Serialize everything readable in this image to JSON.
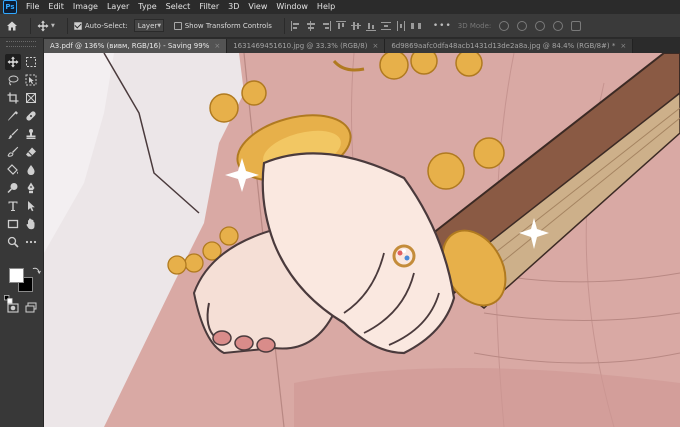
{
  "menubar": {
    "app_logo": "Ps",
    "items": [
      "File",
      "Edit",
      "Image",
      "Layer",
      "Type",
      "Select",
      "Filter",
      "3D",
      "View",
      "Window",
      "Help"
    ]
  },
  "options": {
    "auto_select_label": "Auto-Select:",
    "auto_select_checked": true,
    "layer_select_value": "Layer",
    "show_transform_label": "Show Transform Controls",
    "show_transform_checked": false,
    "more_label": "•••",
    "mode_3d_label": "3D Mode:"
  },
  "tabs": [
    {
      "label": "A3.pdf @ 136% (вивм, RGB/16) - Saving 99%",
      "active": true
    },
    {
      "label": "1631469451610.jpg @ 33.3% (RGB/8)",
      "active": false
    },
    {
      "label": "6d9869aafc0dfa48acb1431d13de2a8a.jpg @ 84.4% (RGB/8#) *",
      "active": false
    }
  ],
  "tab_close_glyph": "×",
  "toolbar": {
    "tools": [
      "move-tool",
      "marquee-tool",
      "lasso-tool",
      "object-select-tool",
      "crop-tool",
      "frame-tool",
      "eyedropper-tool",
      "spot-heal-tool",
      "brush-tool",
      "stamp-tool",
      "history-brush-tool",
      "eraser-tool",
      "paint-bucket-tool",
      "blur-tool",
      "dodge-tool",
      "pen-tool",
      "type-tool",
      "path-select-tool",
      "rectangle-tool",
      "hand-tool",
      "zoom-tool",
      "more-tools"
    ],
    "foreground_color": "#ffffff",
    "background_color": "#000000"
  },
  "colors": {
    "menubar_bg": "#2b2b2b",
    "panel_bg": "#383838",
    "accent": "#31a8ff",
    "canvas_skirt": "#d9a9a4",
    "gold": "#e7b04a"
  }
}
